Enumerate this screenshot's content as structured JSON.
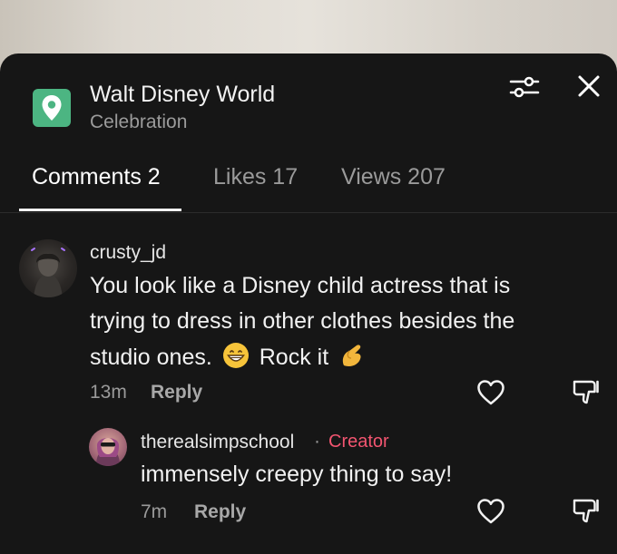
{
  "location": {
    "name": "Walt Disney World",
    "subtitle": "Celebration",
    "icon": "location-pin-icon",
    "color": "#4cb582"
  },
  "header": {
    "filter_icon": "sliders-icon",
    "close_icon": "close-icon"
  },
  "tabs": [
    {
      "label": "Comments 2",
      "active": true
    },
    {
      "label": "Likes 17",
      "active": false
    },
    {
      "label": "Views 207",
      "active": false
    }
  ],
  "comments": [
    {
      "username": "crusty_jd",
      "text_line1": "You look like a Disney child actress that is",
      "text_line2": "trying to dress in other clothes besides the",
      "text_line3a": "studio ones.",
      "text_line3b": "Rock it",
      "emoji1": "grinning-face-emoji",
      "emoji2": "pinching-hand-emoji",
      "time": "13m",
      "reply_label": "Reply"
    },
    {
      "username": "therealsimpschool",
      "separator": "·",
      "badge": "Creator",
      "badge_color": "#f25570",
      "text": "immensely creepy thing to say!",
      "time": "7m",
      "reply_label": "Reply"
    }
  ]
}
